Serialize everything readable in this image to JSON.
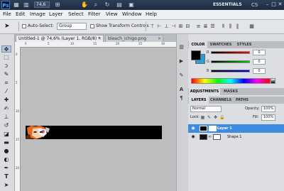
{
  "app": {
    "logo_text": "Ps",
    "zoom_select": "74,6",
    "workspace": "ESSENTIALS",
    "cs_live": "CS"
  },
  "menu": [
    "File",
    "Edit",
    "Image",
    "Layer",
    "Select",
    "Filter",
    "View",
    "Window",
    "Help"
  ],
  "options": {
    "auto_select_label": "Auto-Select:",
    "auto_select_value": "Group",
    "transform_label": "Show Transform Controls"
  },
  "tabs": [
    {
      "label": "Untitled-1 @ 74,6% (Layer 1, RGB/8) *"
    },
    {
      "label": "bleach_ichigo.png"
    }
  ],
  "ruler": {
    "h_ticks": [
      "0",
      "5",
      "10",
      "15",
      "20",
      "25",
      "30"
    ],
    "v_ticks": [
      "0",
      "5",
      "10",
      "15",
      "20"
    ]
  },
  "color_panel": {
    "tabs": [
      "COLOR",
      "SWATCHES",
      "STYLES"
    ],
    "sliders": [
      {
        "label": "R",
        "value": "0"
      },
      {
        "label": "G",
        "value": "0"
      },
      {
        "label": "B",
        "value": "0"
      }
    ],
    "fg_color": "#000000",
    "bg_color": "#26a0d6"
  },
  "adjust_panel": {
    "tabs": [
      "ADJUSTMENTS",
      "MASKS"
    ]
  },
  "layers_panel": {
    "tabs": [
      "LAYERS",
      "CHANNELS",
      "PATHS"
    ],
    "blend_mode": "Normal",
    "opacity_label": "Opacity:",
    "opacity_value": "100%",
    "lock_label": "Lock:",
    "fill_label": "Fill:",
    "fill_value": "100%",
    "layers": [
      {
        "name": "Layer 1",
        "selected": true
      },
      {
        "name": "Shape 1",
        "selected": false
      }
    ]
  }
}
